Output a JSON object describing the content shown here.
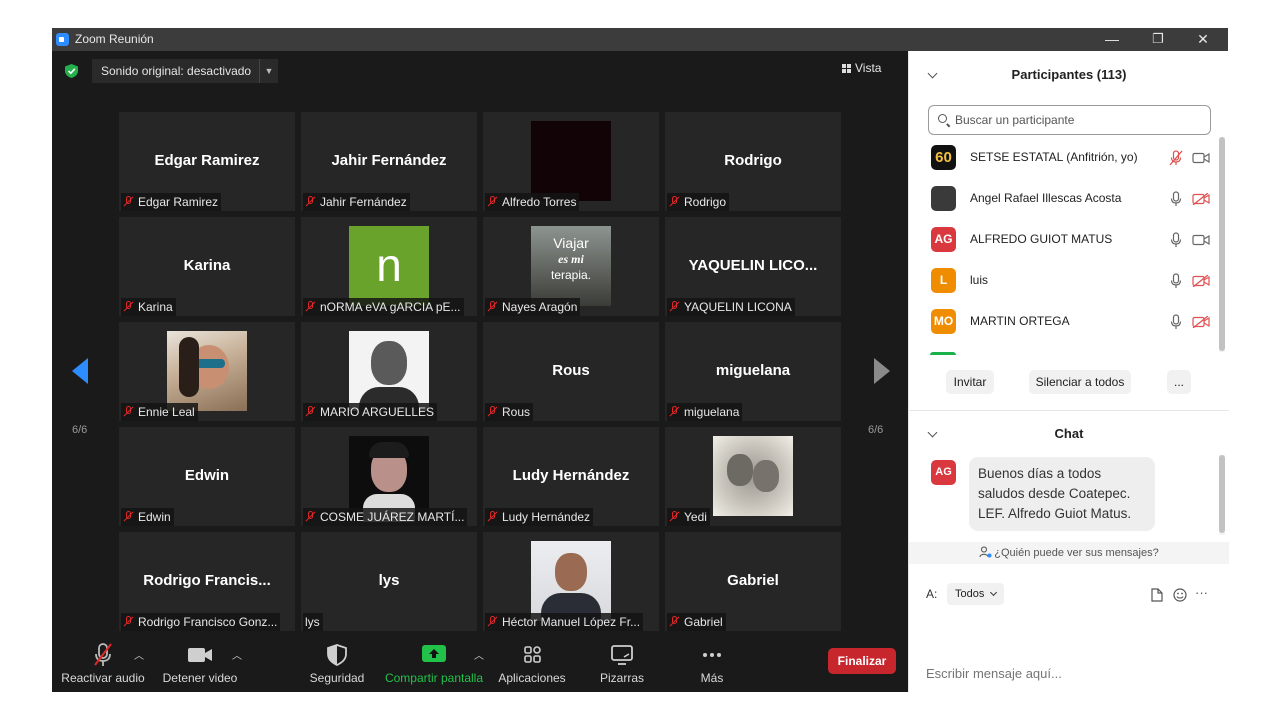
{
  "window": {
    "title": "Zoom Reunión",
    "controls": {
      "minimize": "—",
      "restore": "❐",
      "close": "✕"
    }
  },
  "meeting": {
    "sound_button": "Sonido original: desactivado",
    "view_button": "Vista",
    "page_left": "6/6",
    "page_right": "6/6",
    "tiles": [
      {
        "big": "Edgar Ramirez",
        "label": "Edgar Ramirez",
        "muted": true
      },
      {
        "big": "Jahir Fernández",
        "label": "Jahir Fernández",
        "muted": true
      },
      {
        "big": "",
        "label": "Alfredo Torres",
        "muted": true,
        "photo": "dark-video"
      },
      {
        "big": "Rodrigo",
        "label": "Rodrigo",
        "muted": true
      },
      {
        "big": "Karina",
        "label": "Karina",
        "muted": true
      },
      {
        "big": "",
        "label": "nORMA eVA gARCIA pE...",
        "muted": true,
        "photo": "letter-n",
        "letter": "n"
      },
      {
        "big": "",
        "label": "Nayes Aragón",
        "muted": true,
        "photo": "travel",
        "photo_text": [
          "Viajar",
          "es mi",
          "terapia."
        ]
      },
      {
        "big": "YAQUELIN LICO...",
        "label": "YAQUELIN LICONA",
        "muted": true
      },
      {
        "big": "",
        "label": "Ennie Leal",
        "muted": true,
        "photo": "selfie"
      },
      {
        "big": "",
        "label": "MARIO ARGUELLES",
        "muted": true,
        "photo": "portrait-bw"
      },
      {
        "big": "Rous",
        "label": "Rous",
        "muted": true
      },
      {
        "big": "miguelana",
        "label": "miguelana",
        "muted": true
      },
      {
        "big": "Edwin",
        "label": "Edwin",
        "muted": true
      },
      {
        "big": "",
        "label": "COSME JUÁREZ MARTÍ...",
        "muted": true,
        "photo": "portrait-dark"
      },
      {
        "big": "Ludy Hernández",
        "label": "Ludy Hernández",
        "muted": true
      },
      {
        "big": "",
        "label": "Yedi",
        "muted": true,
        "photo": "sketch"
      },
      {
        "big": "Rodrigo  Francis...",
        "label": "Rodrigo Francisco Gonz...",
        "muted": true
      },
      {
        "big": "lys",
        "label": "lys",
        "muted": false
      },
      {
        "big": "",
        "label": "Héctor Manuel López Fr...",
        "muted": true,
        "photo": "webcam"
      },
      {
        "big": "Gabriel",
        "label": "Gabriel",
        "muted": true
      }
    ]
  },
  "toolbar": {
    "unmute": "Reactivar audio",
    "stop_video": "Detener video",
    "security": "Seguridad",
    "share": "Compartir pantalla",
    "apps": "Aplicaciones",
    "whiteboards": "Pizarras",
    "more": "Más",
    "end": "Finalizar"
  },
  "participants": {
    "title": "Participantes (113)",
    "search_placeholder": "Buscar un participante",
    "list": [
      {
        "name": "SETSE ESTATAL (Anfitrión, yo)",
        "avatar_text": "60",
        "avatar_color": "#111111",
        "mic": "muted",
        "cam": "on"
      },
      {
        "name": "Angel Rafael Illescas Acosta",
        "avatar_text": "",
        "avatar_color": "#3a3a3a",
        "mic": "on",
        "cam": "off"
      },
      {
        "name": "ALFREDO GUIOT MATUS",
        "avatar_text": "AG",
        "avatar_color": "#d9383f",
        "mic": "on",
        "cam": "on"
      },
      {
        "name": "luis",
        "avatar_text": "L",
        "avatar_color": "#f08c00",
        "mic": "on",
        "cam": "off"
      },
      {
        "name": "MARTIN ORTEGA",
        "avatar_text": "MO",
        "avatar_color": "#f08c00",
        "mic": "on",
        "cam": "off"
      }
    ],
    "invite": "Invitar",
    "mute_all": "Silenciar a todos",
    "more": "..."
  },
  "chat": {
    "title": "Chat",
    "message": {
      "avatar": "AG",
      "lines": [
        "Buenos días a todos",
        "saludos desde Coatepec.",
        "LEF. Alfredo Guiot Matus."
      ]
    },
    "who_can_see": "¿Quién puede ver sus mensajes?",
    "to_label": "A:",
    "recipient": "Todos",
    "input_placeholder": "Escribir mensaje aquí...",
    "more": "···"
  },
  "colors": {
    "accent": "#2d8cff",
    "muted_red": "#e02828",
    "share_green": "#22c14a",
    "end_red": "#c8262d"
  }
}
